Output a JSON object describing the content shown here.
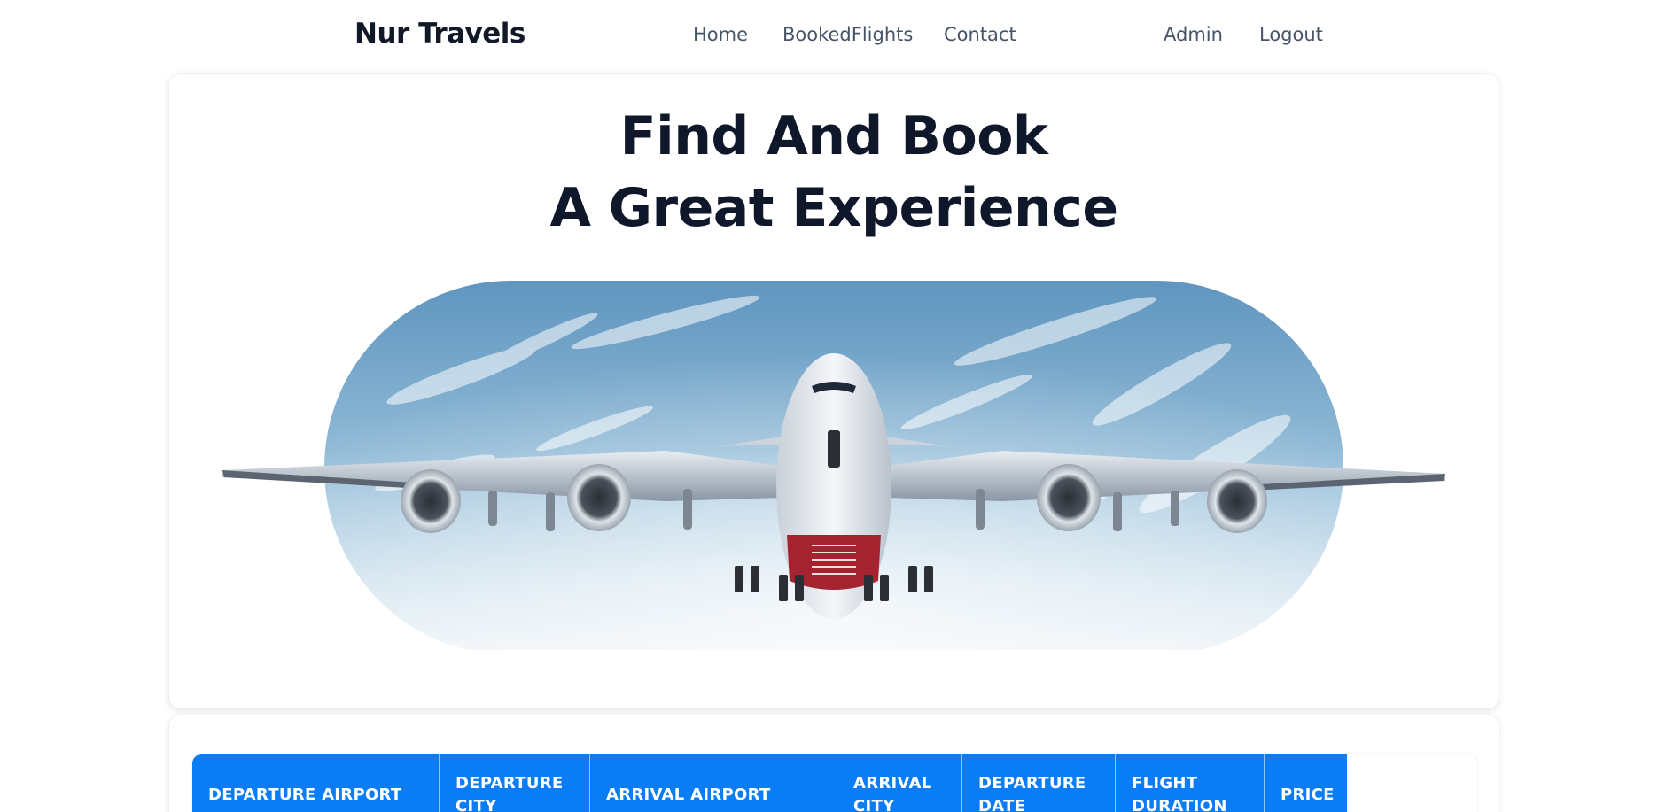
{
  "nav": {
    "brand": "Nur Travels",
    "links": [
      "Home",
      "BookedFlights",
      "Contact"
    ],
    "right_links": [
      "Admin",
      "Logout"
    ]
  },
  "hero": {
    "title_line1": "Find And Book",
    "title_line2": "A Great Experience",
    "image": "airplane-flying-in-sky"
  },
  "table": {
    "headers": [
      "DEPARTURE AIRPORT",
      "DEPARTURE CITY",
      "ARRIVAL AIRPORT",
      "ARRIVAL CITY",
      "DEPARTURE DATE",
      "FLIGHT DURATION",
      "PRICE"
    ]
  },
  "colors": {
    "accent": "#0a7cf6",
    "heading": "#0f172a",
    "nav_text": "#475569"
  }
}
